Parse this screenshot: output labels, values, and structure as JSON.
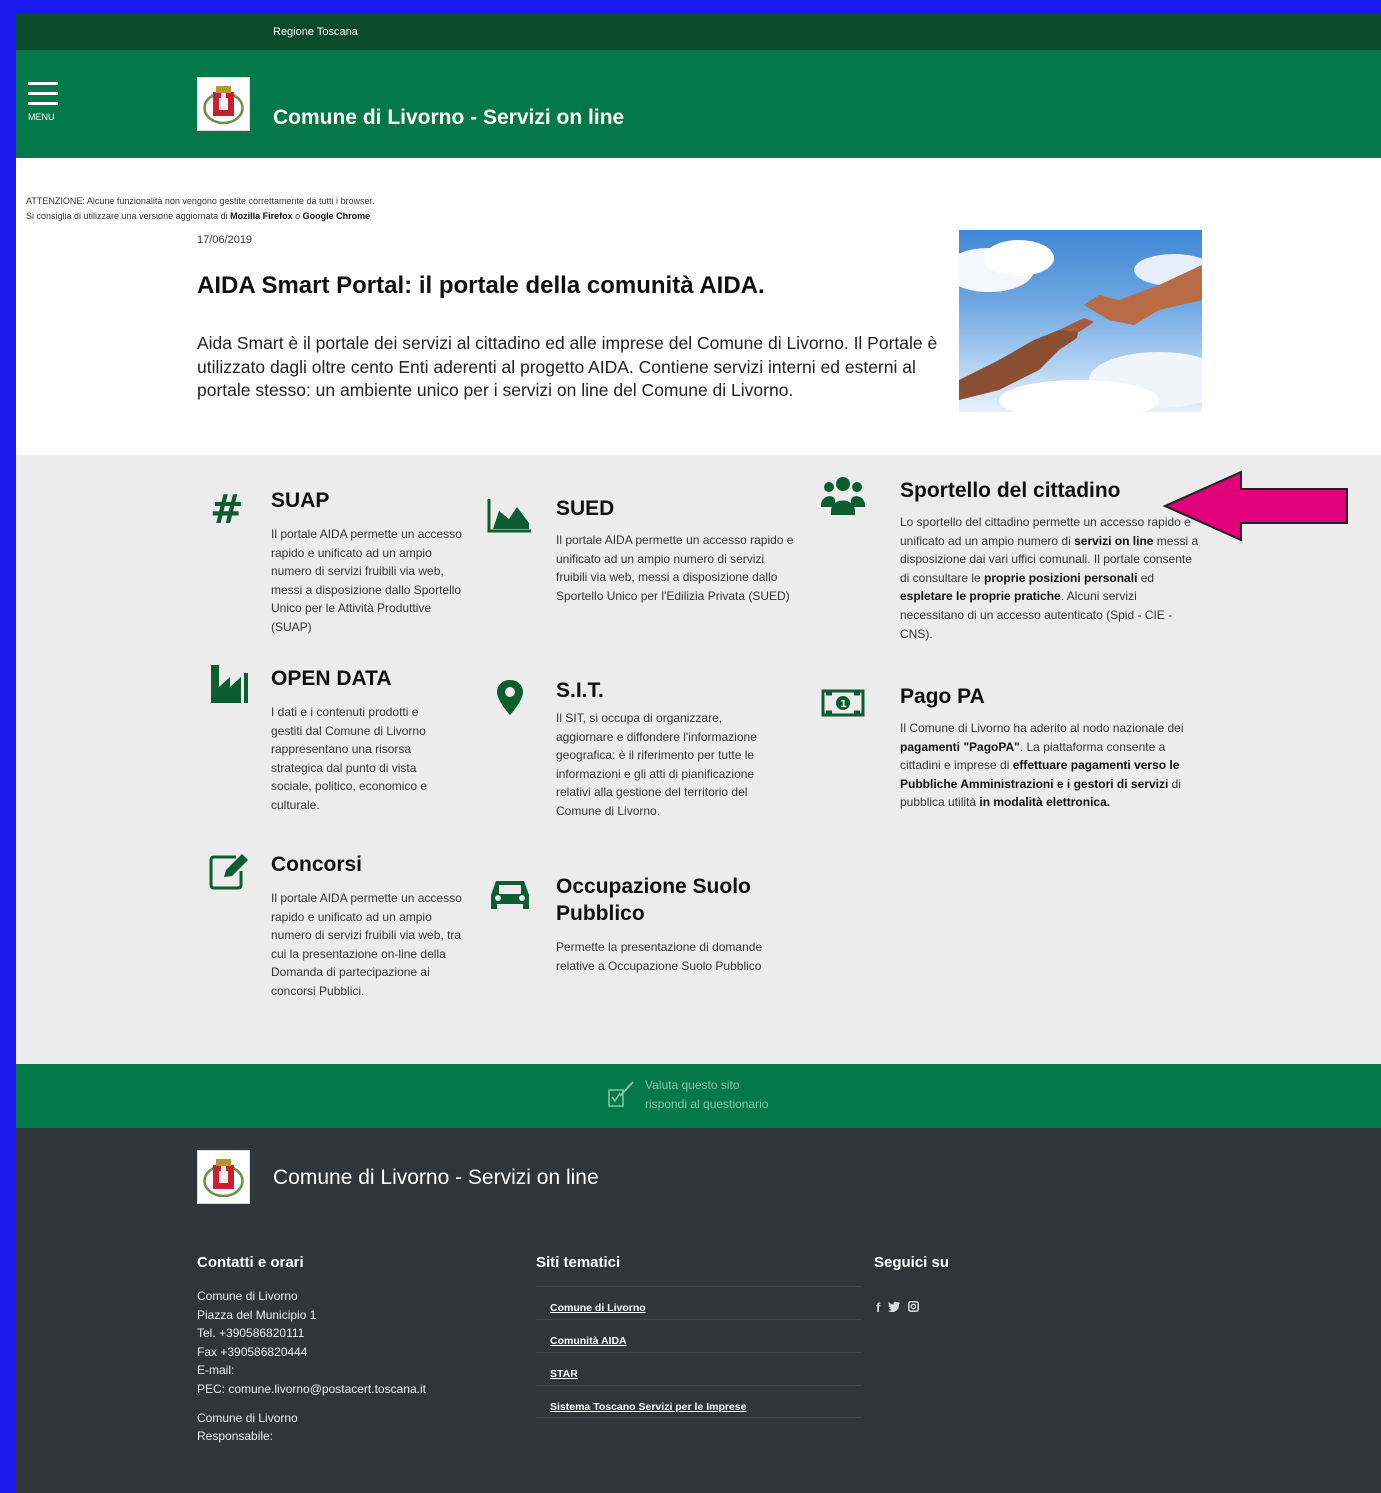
{
  "topbar": {
    "region": "Regione Toscana"
  },
  "header": {
    "menu_label": "MENU",
    "site_title": "Comune di Livorno - Servizi on line",
    "crest_icon": "municipal-crest-icon"
  },
  "warning": {
    "line1": "ATTENZIONE: Alcune funzionalità non vengono gestite correttamente da tutti i browser.",
    "line2_prefix": "Si consiglia di utilizzare una versione aggiornata di ",
    "browser1": "Mozilla Firefox",
    "conj": " o ",
    "browser2": "Google Chrome"
  },
  "hero": {
    "date": "17/06/2019",
    "title": "AIDA Smart Portal: il portale della comunità AIDA.",
    "text": "Aida Smart è il portale dei servizi al cittadino ed alle imprese del Comune di Livorno. Il Portale è utilizzato dagli oltre cento Enti aderenti al progetto AIDA. Contiene servizi interni ed esterni al portale stesso: un ambiente unico per i servizi on line del Comune di Livorno."
  },
  "services": {
    "suap": {
      "title": "SUAP",
      "desc": "Il portale AIDA permette un accesso rapido e unificato ad un ampio numero di servizi fruibili via web, messi a disposizione dallo Sportello Unico per le Attività Produttive (SUAP)",
      "icon": "hashtag-icon"
    },
    "sued": {
      "title": "SUED",
      "desc": "Il portale AIDA permette un accesso rapido e unificato ad un ampio numero di servizi fruibili via web, messi a disposizione dallo Sportello Unico per l'Edilizia Privata (SUED)",
      "icon": "area-chart-icon"
    },
    "sportello": {
      "title": "Sportello del cittadino",
      "icon": "users-icon",
      "d1": "Lo sportello del cittadino permette un accesso rapido e unificato ad un ampio numero di ",
      "d2": "servizi on line",
      "d3": " messi a disposizione dai vari uffici comunali. Il portale consente di consultare le ",
      "d4": "proprie posizioni personali",
      "d5": " ed ",
      "d6": "espletare le proprie pratiche",
      "d7": ". Alcuni servizi necessitano di un accesso autenticato (Spid - CIE - CNS)."
    },
    "opendata": {
      "title": "OPEN DATA",
      "desc": "I dati e i contenuti prodotti e gestiti dal Comune di Livorno rappresentano una risorsa strategica dal punto di vista sociale, politico, economico e culturale.",
      "icon": "factory-icon"
    },
    "sit": {
      "title": "S.I.T.",
      "desc": "Il SIT, si occupa di organizzare, aggiornare e diffondere l'informazione geografica: è il riferimento per tutte le informazioni e gli atti di pianificazione relativi alla gestione del territorio del Comune di Livorno.",
      "icon": "map-marker-icon"
    },
    "pagopa": {
      "title": "Pago PA",
      "icon": "money-bill-icon",
      "d1": "Il Comune di Livorno ha aderito al nodo nazionale dei ",
      "d2": "pagamenti \"PagoPA\"",
      "d3": ". La piattaforma consente a cittadini e imprese di ",
      "d4": "effettuare pagamenti verso le Pubbliche Amministrazioni e i gestori di servizi",
      "d5": " di pubblica utilità ",
      "d6": "in modalità elettronica."
    },
    "concorsi": {
      "title": "Concorsi",
      "desc": "Il portale AIDA permette un accesso rapido e unificato ad un ampio numero di servizi fruibili via web, tra cui la presentazione on-line della Domanda di partecipazione ai concorsi Pubblici.",
      "icon": "edit-icon"
    },
    "osp": {
      "title1": "Occupazione Suolo",
      "title2": "Pubblico",
      "desc": "Permette la presentazione di domande relative a Occupazione Suolo Pubblico",
      "icon": "car-icon"
    }
  },
  "feedback": {
    "line1": "Valuta questo sito",
    "line2": "rispondi al questionario",
    "icon": "survey-icon"
  },
  "footer": {
    "site_title": "Comune di Livorno - Servizi on line",
    "contacts_heading": "Contatti e orari",
    "contacts": [
      "Comune di Livorno",
      "Piazza del Municipio 1",
      "Tel. +390586820111",
      "Fax +390586820444",
      "E-mail:",
      "PEC: comune.livorno@postacert.toscana.it"
    ],
    "contacts2": [
      "Comune di Livorno",
      "Responsabile:"
    ],
    "links_heading": "Siti tematici",
    "links": [
      "Comune di Livorno",
      "Comunità AIDA",
      "STAR",
      "Sistema Toscano Servizi per le Imprese"
    ],
    "social_heading": "Seguici su",
    "social": {
      "facebook": "f",
      "twitter": "🐦",
      "instagram": "◙"
    }
  },
  "colors": {
    "brand_green": "#047848",
    "dark_green": "#0b4a2b",
    "icon_green": "#0d5c32",
    "footer_bg": "#2f3538",
    "annotation_arrow": "#e2007a"
  }
}
